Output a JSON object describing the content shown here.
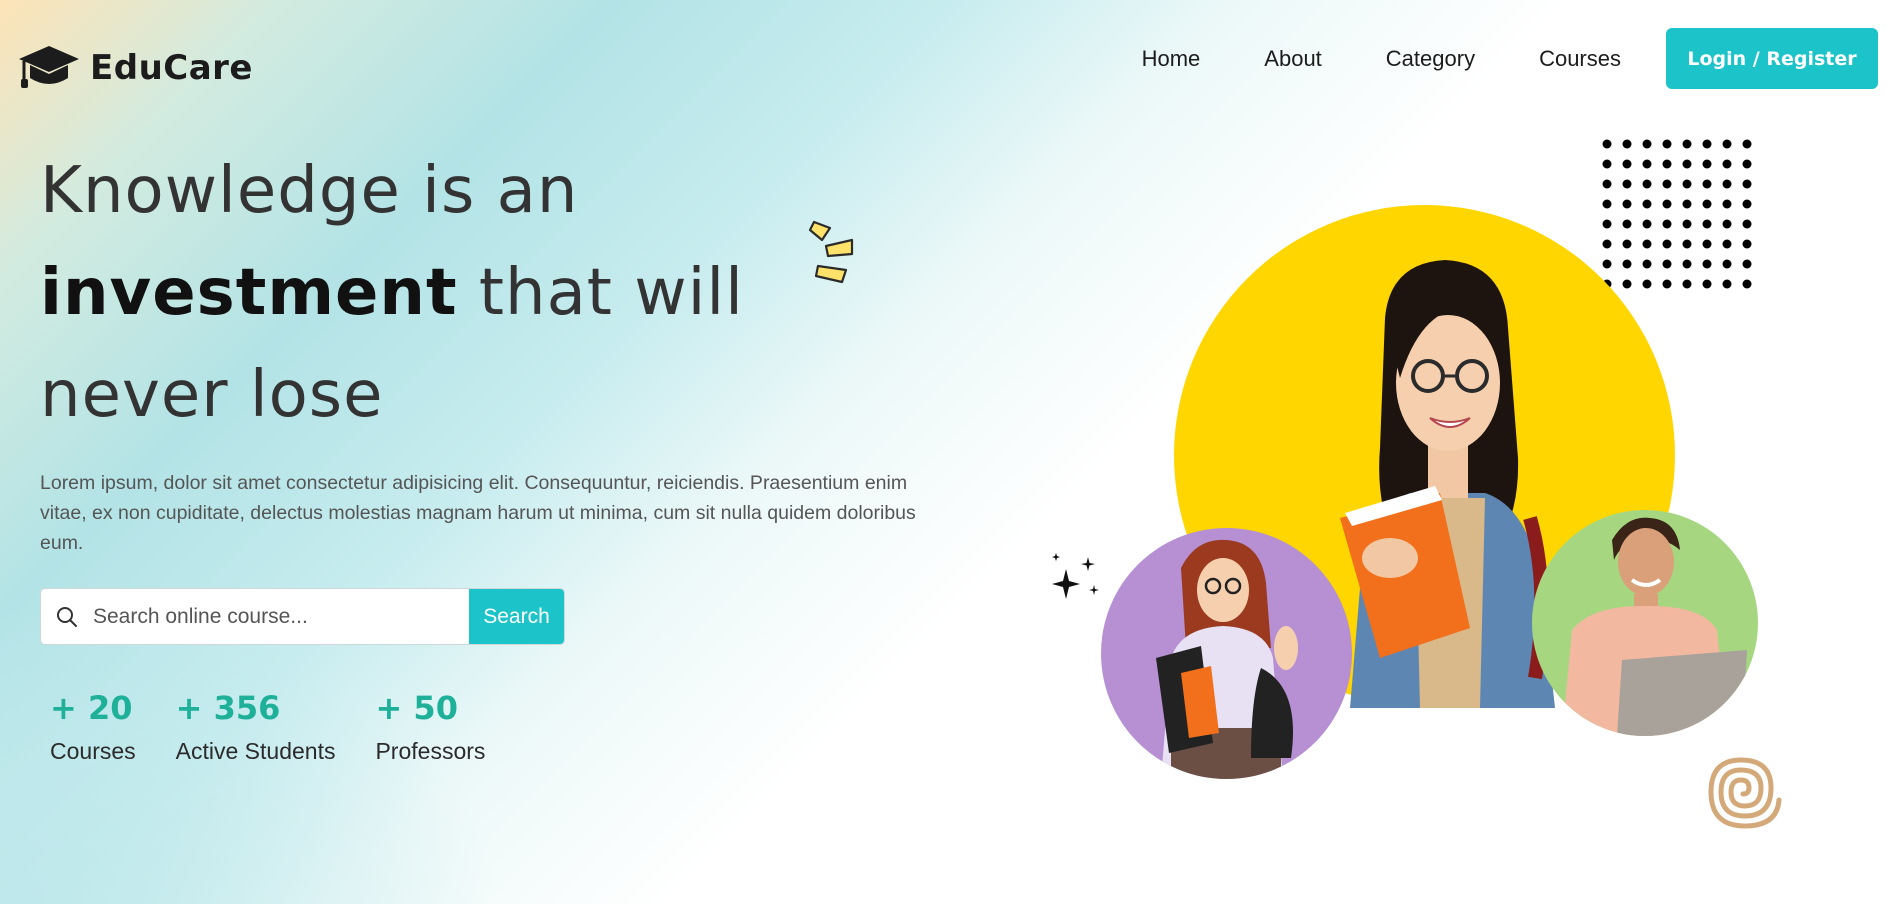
{
  "brand": {
    "name": "EduCare"
  },
  "nav": {
    "items": [
      {
        "label": "Home"
      },
      {
        "label": "About"
      },
      {
        "label": "Category"
      },
      {
        "label": "Courses"
      }
    ],
    "login_label": "Login / Register"
  },
  "hero": {
    "title_line1": "Knowledge is an",
    "title_line2_bold": "investment",
    "title_line2_rest": " that will",
    "title_line3": "never lose",
    "description": "Lorem ipsum, dolor sit amet consectetur adipisicing elit. Consequuntur, reiciendis. Praesentium enim vitae, ex non cupiditate, delectus molestias magnam harum ut minima, cum sit nulla quidem doloribus eum."
  },
  "search": {
    "placeholder": "Search online course...",
    "button_label": "Search"
  },
  "stats": [
    {
      "value": "+ 20",
      "label": "Courses"
    },
    {
      "value": "+ 356",
      "label": "Active Students"
    },
    {
      "value": "+ 50",
      "label": "Professors"
    }
  ],
  "icons": {
    "logo": "graduation-cap-icon",
    "search": "magnifier-icon",
    "decor": [
      "yellow-spark-lines",
      "dot-grid",
      "sparkle-stars",
      "tan-spiral"
    ]
  },
  "colors": {
    "accent": "#1cc4c9",
    "stat_green": "#1fb09a",
    "yellow_circle": "#ffd600",
    "purple_circle": "#b78fd3",
    "green_circle": "#a6d780"
  }
}
